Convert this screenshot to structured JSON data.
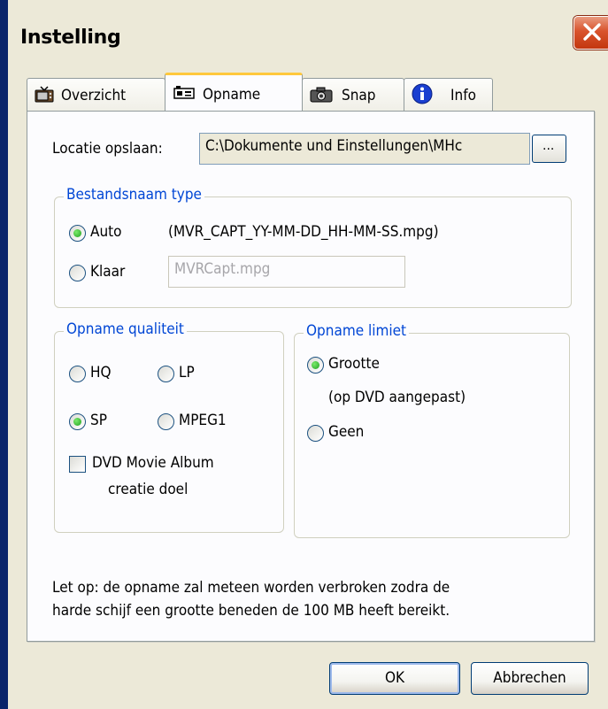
{
  "window": {
    "title": "Instelling"
  },
  "tabs": [
    {
      "label": "Overzicht",
      "icon": "tv-icon",
      "active": false
    },
    {
      "label": "Opname",
      "icon": "video-recorder-icon",
      "active": true
    },
    {
      "label": "Snap",
      "icon": "camera-icon",
      "active": false
    },
    {
      "label": "Info",
      "icon": "info-icon",
      "active": false
    }
  ],
  "location": {
    "label": "Locatie opslaan:",
    "value": "C:\\Dokumente und Einstellungen\\MHc",
    "browse_label": "..."
  },
  "filename_type": {
    "title": "Bestandsnaam type",
    "auto_label": "Auto",
    "auto_pattern": "(MVR_CAPT_YY-MM-DD_HH-MM-SS.mpg)",
    "auto_checked": true,
    "klaar_label": "Klaar",
    "klaar_value": "MVRCapt.mpg",
    "klaar_checked": false
  },
  "quality": {
    "title": "Opname qualiteit",
    "options": [
      {
        "label": "HQ",
        "checked": false
      },
      {
        "label": "LP",
        "checked": false
      },
      {
        "label": "SP",
        "checked": true
      },
      {
        "label": "MPEG1",
        "checked": false
      }
    ],
    "dvd_label_line1": "DVD Movie Album",
    "dvd_label_line2": "creatie doel",
    "dvd_checked": false
  },
  "limit": {
    "title": "Opname limiet",
    "size_label": "Grootte",
    "size_note": "(op DVD aangepast)",
    "size_checked": true,
    "none_label": "Geen",
    "none_checked": false
  },
  "notice": {
    "line1": "Let op: de opname zal meteen worden verbroken zodra de",
    "line2": "harde schijf een grootte beneden de 100 MB heeft bereikt."
  },
  "buttons": {
    "ok": "OK",
    "cancel": "Abbrechen"
  },
  "colors": {
    "group_title": "#0046D5",
    "active_tab_accent": "#FFC83C",
    "close_button": "#D9532C"
  }
}
